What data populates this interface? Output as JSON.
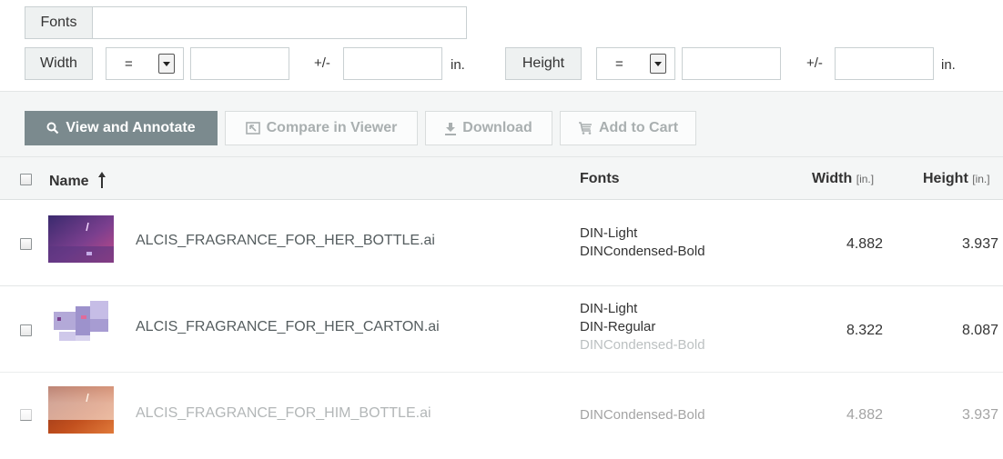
{
  "filters": {
    "fonts_label": "Fonts",
    "fonts_value": "",
    "width_label": "Width",
    "width_operator": "=",
    "width_value": "",
    "width_pm": "+/-",
    "width_tolerance": "",
    "width_unit": "in.",
    "height_label": "Height",
    "height_operator": "=",
    "height_value": "",
    "height_pm": "+/-",
    "height_tolerance": "",
    "height_unit": "in."
  },
  "toolbar": {
    "view_annotate": "View and Annotate",
    "compare": "Compare in Viewer",
    "download": "Download",
    "add_to_cart": "Add to Cart"
  },
  "table": {
    "columns": {
      "name": "Name",
      "fonts": "Fonts",
      "width": "Width",
      "width_unit": "[in.]",
      "height": "Height",
      "height_unit": "[in.]"
    },
    "rows": [
      {
        "filename": "ALCIS_FRAGRANCE_FOR_HER_BOTTLE.ai",
        "fonts": [
          "DIN-Light",
          "DINCondensed-Bold"
        ],
        "width": "4.882",
        "height": "3.937"
      },
      {
        "filename": "ALCIS_FRAGRANCE_FOR_HER_CARTON.ai",
        "fonts": [
          "DIN-Light",
          "DIN-Regular",
          "DINCondensed-Bold"
        ],
        "width": "8.322",
        "height": "8.087"
      },
      {
        "filename": "ALCIS_FRAGRANCE_FOR_HIM_BOTTLE.ai",
        "fonts": [
          "DINCondensed-Bold"
        ],
        "width": "4.882",
        "height": "3.937"
      }
    ]
  },
  "colors": {
    "primary_button": "#7b8a8e",
    "toolbar_bg": "#f4f6f6",
    "label_bg": "#eef1f1"
  }
}
